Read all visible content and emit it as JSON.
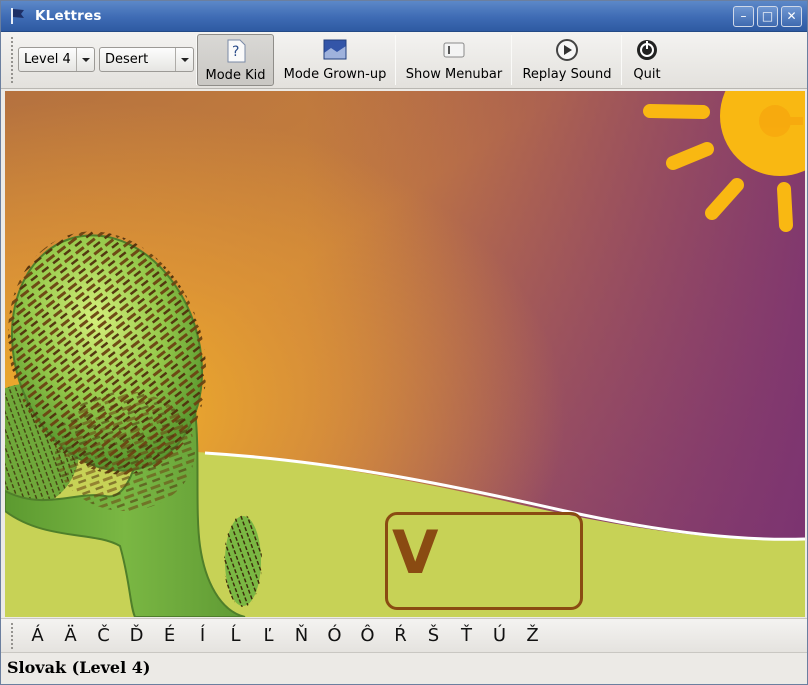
{
  "window": {
    "title": "KLettres",
    "minimize_glyph": "–",
    "maximize_glyph": "□",
    "close_glyph": "✕"
  },
  "toolbar": {
    "level_select": {
      "value": "Level 4"
    },
    "theme_select": {
      "value": "Desert"
    },
    "buttons": [
      {
        "label": "Mode Kid",
        "icon": "kid-mode-icon",
        "active": true
      },
      {
        "label": "Mode Grown-up",
        "icon": "grown-up-mode-icon",
        "active": false
      },
      {
        "label": "Show Menubar",
        "icon": "menubar-icon",
        "active": false
      },
      {
        "label": "Replay Sound",
        "icon": "play-icon",
        "active": false
      },
      {
        "label": "Quit",
        "icon": "quit-icon",
        "active": false
      }
    ]
  },
  "game": {
    "typed_letter": "V",
    "colors": {
      "sky_top": "#b86a45",
      "sky_bottom": "#e3a33a",
      "sky_purple": "#8c3c6a",
      "sun": "#f9b812",
      "sand": "#c7d256",
      "cactus": "#6fa83a",
      "spines": "#6b4312",
      "answer": "#8a4b12"
    }
  },
  "letters": [
    "Á",
    "Ä",
    "Č",
    "Ď",
    "É",
    "Í",
    "Ĺ",
    "Ľ",
    "Ň",
    "Ó",
    "Ô",
    "Ŕ",
    "Š",
    "Ť",
    "Ú",
    "Ž"
  ],
  "status": {
    "text": "Slovak (Level 4)"
  }
}
